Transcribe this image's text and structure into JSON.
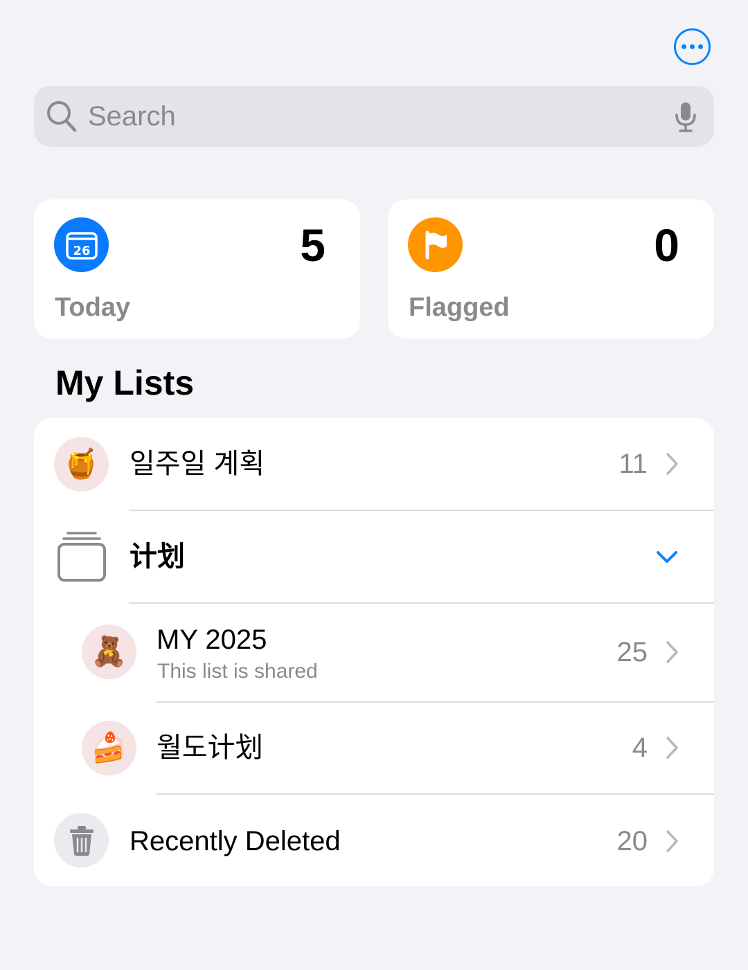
{
  "header": {
    "more_icon": "ellipsis-circle-icon",
    "accent": "#0a84ff"
  },
  "search": {
    "placeholder": "Search",
    "search_icon": "magnifier-icon",
    "mic_icon": "microphone-icon"
  },
  "smart_lists": [
    {
      "label": "Today",
      "count": "5",
      "icon": "calendar-icon",
      "icon_text": "26",
      "color": "#0a7aff"
    },
    {
      "label": "Flagged",
      "count": "0",
      "icon": "flag-icon",
      "color": "#ff9500"
    }
  ],
  "section_title": "My Lists",
  "lists": [
    {
      "title": "일주일 계획",
      "count": "11",
      "emoji": "🍯"
    },
    {
      "title": "计划",
      "group": true,
      "icon": "stack-folder-icon"
    },
    {
      "title": "MY 2025",
      "subtitle": "This list is shared",
      "count": "25",
      "emoji": "🧸"
    },
    {
      "title": "월도计划",
      "count": "4",
      "emoji": "🍰"
    },
    {
      "title": "Recently Deleted",
      "count": "20",
      "icon": "trash-icon"
    }
  ]
}
